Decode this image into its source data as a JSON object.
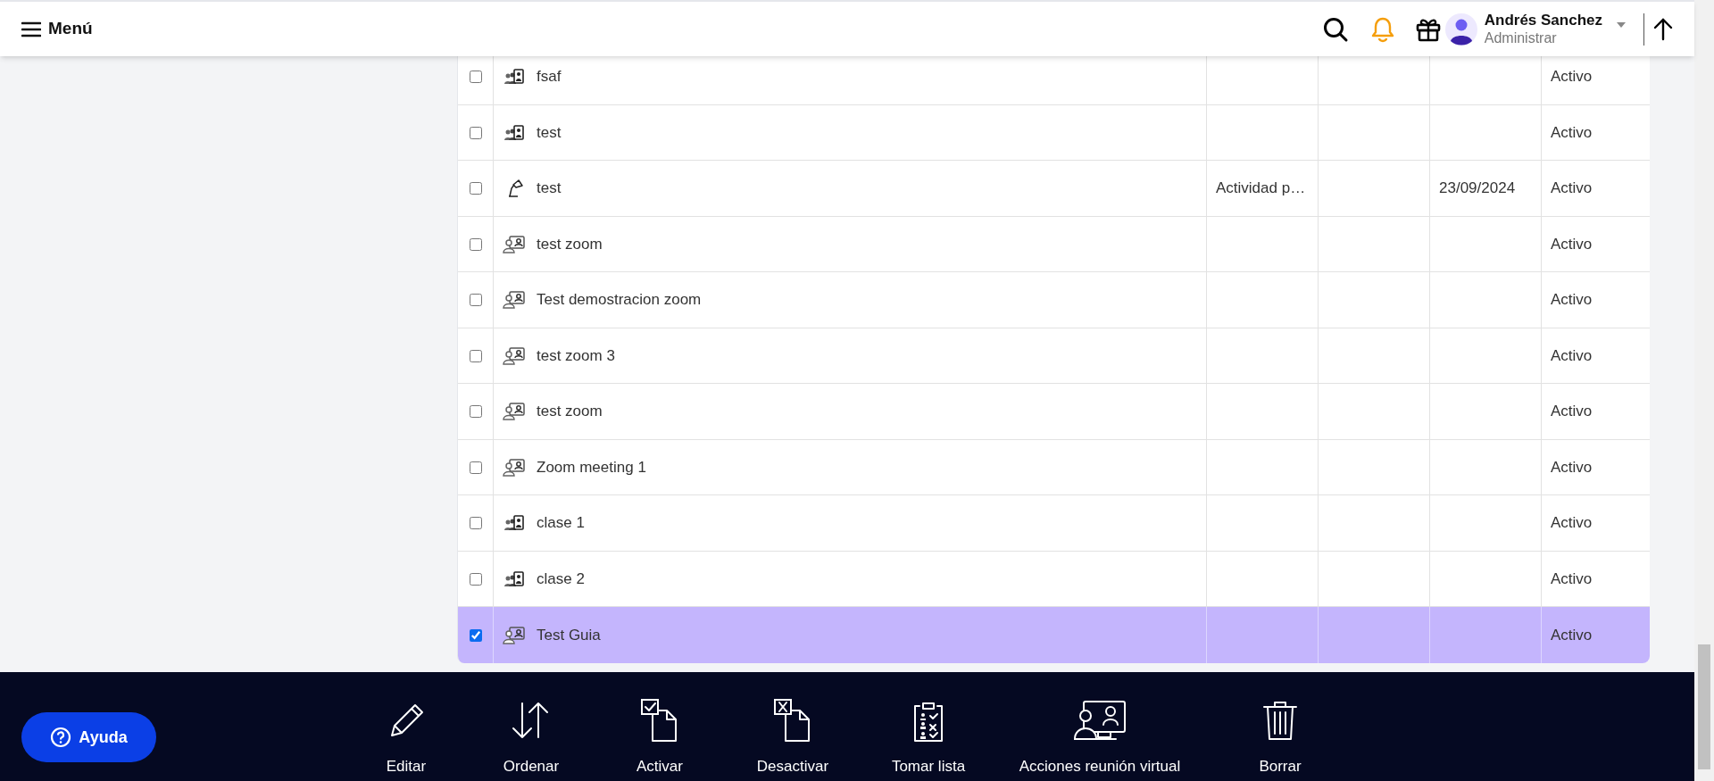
{
  "header": {
    "menu_label": "Menú",
    "user": {
      "name": "Andrés Sanchez",
      "role": "Administrar"
    }
  },
  "table": {
    "rows": [
      {
        "kind": "group",
        "selected": false,
        "name": "fsaf",
        "column_6": "Activo"
      },
      {
        "kind": "group",
        "selected": false,
        "name": "test",
        "column_6": "Activo"
      },
      {
        "kind": "lamp",
        "selected": false,
        "name": "test",
        "column_3": "Actividad p…",
        "column_5": "23/09/2024",
        "column_6": "Activo"
      },
      {
        "kind": "meeting",
        "selected": false,
        "name": "test zoom",
        "column_6": "Activo"
      },
      {
        "kind": "meeting",
        "selected": false,
        "name": "Test demostracion zoom",
        "column_6": "Activo"
      },
      {
        "kind": "meeting",
        "selected": false,
        "name": "test zoom 3",
        "column_6": "Activo"
      },
      {
        "kind": "meeting",
        "selected": false,
        "name": "test zoom",
        "column_6": "Activo"
      },
      {
        "kind": "meeting",
        "selected": false,
        "name": "Zoom meeting 1",
        "column_6": "Activo"
      },
      {
        "kind": "group",
        "selected": false,
        "name": "clase 1",
        "column_6": "Activo"
      },
      {
        "kind": "group",
        "selected": false,
        "name": "clase 2",
        "column_6": "Activo"
      },
      {
        "kind": "meeting",
        "selected": true,
        "name": "Test Guia",
        "column_6": "Activo"
      }
    ]
  },
  "help_button": {
    "label": "Ayuda"
  },
  "actions": [
    {
      "kind": "edit",
      "label": "Editar"
    },
    {
      "kind": "sort",
      "label": "Ordenar"
    },
    {
      "kind": "activate",
      "label": "Activar"
    },
    {
      "kind": "deactivate",
      "label": "Desactivar"
    },
    {
      "kind": "attendance",
      "label": "Tomar lista"
    },
    {
      "kind": "virtual",
      "label": "Acciones reunión virtual"
    },
    {
      "kind": "delete",
      "label": "Borrar"
    }
  ]
}
